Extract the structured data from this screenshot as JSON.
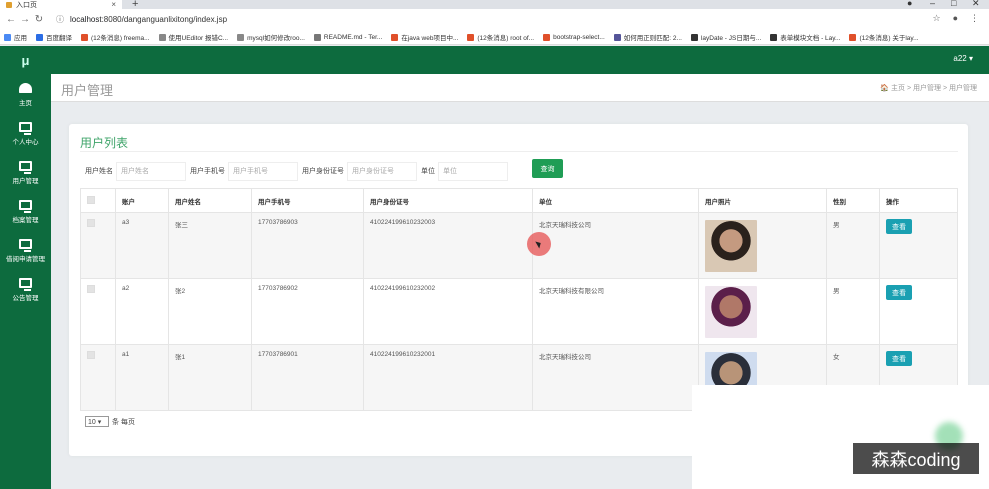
{
  "browser": {
    "tab_title": "入口页",
    "url_host": "localhost",
    "url_rest": ":8080/danganguanlixitong/index.jsp",
    "bookmarks": [
      {
        "label": "应用",
        "color": "#4a8af4"
      },
      {
        "label": "百度翻译",
        "color": "#2b6de5"
      },
      {
        "label": "(12条消息) freema...",
        "color": "#e0502a"
      },
      {
        "label": "使用UEditor 报错C...",
        "color": "#888888"
      },
      {
        "label": "mysql如何修改roo...",
        "color": "#888888"
      },
      {
        "label": "README.md - Ter...",
        "color": "#777777"
      },
      {
        "label": "在java web项目中...",
        "color": "#e0502a"
      },
      {
        "label": "(12条消息) root of...",
        "color": "#e0502a"
      },
      {
        "label": "bootstrap-select...",
        "color": "#e0502a"
      },
      {
        "label": "如何用正则匹配: 2...",
        "color": "#555599"
      },
      {
        "label": "layDate - JS日期与...",
        "color": "#333333"
      },
      {
        "label": "表单模块文档 - Lay...",
        "color": "#333333"
      },
      {
        "label": "(12条消息) 关于lay...",
        "color": "#e0502a"
      }
    ]
  },
  "app": {
    "logo": "μ",
    "user": "a22 ▾"
  },
  "sidebar": {
    "items": [
      {
        "label": "主页",
        "icon": "dashboard-icon"
      },
      {
        "label": "个人中心",
        "icon": "monitor-icon"
      },
      {
        "label": "用户管理",
        "icon": "monitor-icon"
      },
      {
        "label": "档案管理",
        "icon": "monitor-icon"
      },
      {
        "label": "借阅申请管理",
        "icon": "monitor-icon"
      },
      {
        "label": "公告管理",
        "icon": "monitor-icon"
      }
    ]
  },
  "header": {
    "title": "用户管理",
    "breadcrumb": "🏠 主页  >  用户管理  >  用户管理"
  },
  "card": {
    "title": "用户列表",
    "filters": [
      {
        "label": "用户姓名",
        "placeholder": "用户姓名"
      },
      {
        "label": "用户手机号",
        "placeholder": "用户手机号"
      },
      {
        "label": "用户身份证号",
        "placeholder": "用户身份证号"
      },
      {
        "label": "单位",
        "placeholder": "单位"
      }
    ],
    "search_label": "查询",
    "columns": [
      "",
      "账户",
      "用户姓名",
      "用户手机号",
      "用户身份证号",
      "单位",
      "用户照片",
      "性别",
      "操作"
    ],
    "rows": [
      {
        "account": "a3",
        "name": "张三",
        "phone": "17703786903",
        "idcard": "410224199610232003",
        "unit": "北京天瑞科技公司",
        "gender": "男",
        "action": "查看",
        "avatar_colors": [
          "#d9c8b4",
          "#2a211c",
          "#c49a80"
        ]
      },
      {
        "account": "a2",
        "name": "张2",
        "phone": "17703786902",
        "idcard": "410224199610232002",
        "unit": "北京天瑞科技有限公司",
        "gender": "男",
        "action": "查看",
        "avatar_colors": [
          "#efe6ee",
          "#5b1f4a",
          "#b07868"
        ]
      },
      {
        "account": "a1",
        "name": "张1",
        "phone": "17703786901",
        "idcard": "410224199610232001",
        "unit": "北京天瑞科技公司",
        "gender": "女",
        "action": "查看",
        "avatar_colors": [
          "#cfdcef",
          "#2a2f3a",
          "#b89478"
        ]
      }
    ],
    "pager": {
      "page_size": "10 ▾",
      "suffix": "条 每页"
    }
  },
  "watermark": "森森coding"
}
